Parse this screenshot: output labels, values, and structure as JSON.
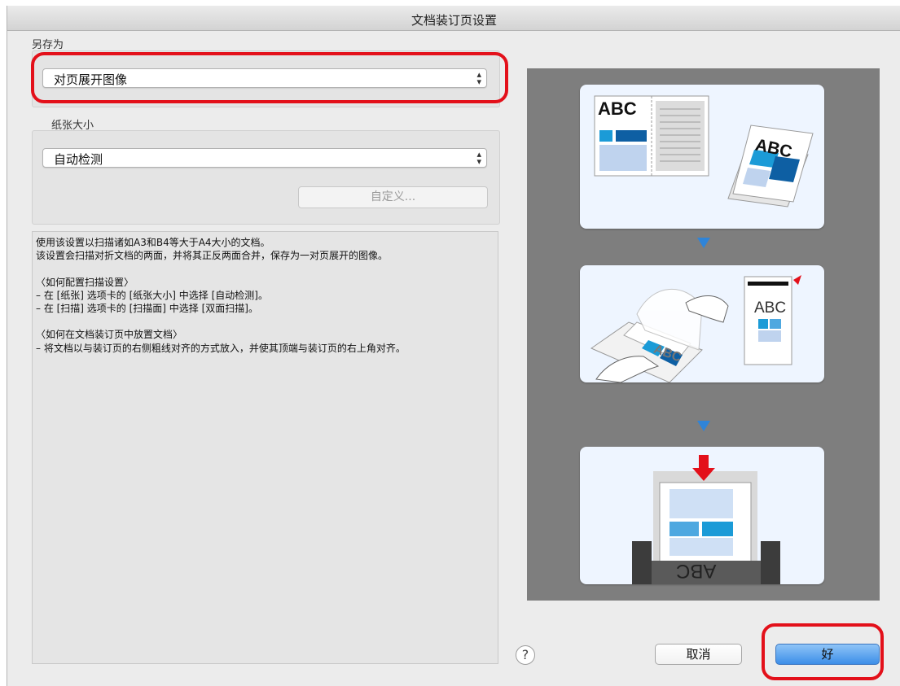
{
  "window": {
    "title": "文档装订页设置"
  },
  "save_as": {
    "label": "另存为",
    "value": "对页展开图像"
  },
  "paper_size": {
    "label": "纸张大小",
    "value": "自动检测",
    "custom_button": "自定义..."
  },
  "description": {
    "lines": [
      "使用该设置以扫描诸如A3和B4等大于A4大小的文档。",
      "该设置会扫描对折文档的两面，并将其正反两面合并，保存为一对页展开的图像。",
      "",
      "〈如何配置扫描设置〉",
      "– 在 [纸张] 选项卡的 [纸张大小] 中选择 [自动检测]。",
      "– 在 [扫描] 选项卡的 [扫描面] 中选择 [双面扫描]。",
      "",
      "〈如何在文档装订页中放置文档〉",
      "– 将文档以与装订页的右侧粗线对齐的方式放入，并使其顶端与装订页的右上角对齐。"
    ]
  },
  "preview": {
    "step1_text": "ABC",
    "step1_folded_text": "ABC",
    "step2_card_text": "ABC",
    "step2_insert_text": "ABC",
    "step3_text": "ABC"
  },
  "buttons": {
    "help": "?",
    "cancel": "取消",
    "ok": "好"
  },
  "colors": {
    "highlight": "#e3101a",
    "accent_blue": "#2f84d8",
    "dark_blue": "#0e5fa3",
    "ok_blue": "#3c8ee8"
  }
}
